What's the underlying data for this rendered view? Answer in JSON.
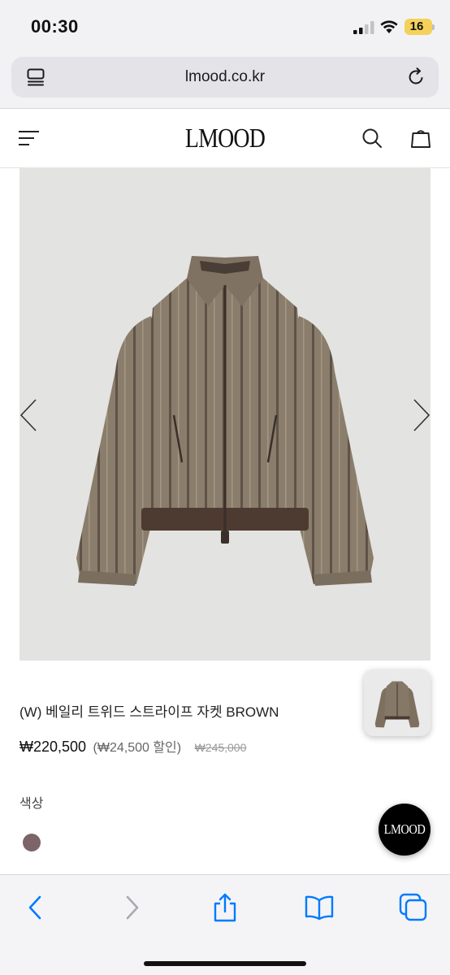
{
  "status_bar": {
    "time": "00:30",
    "battery": "16"
  },
  "browser": {
    "url": "lmood.co.kr",
    "icons": [
      "reader-icon",
      "reload-icon"
    ]
  },
  "site_header": {
    "brand": "LMOOD",
    "icons": [
      "menu-icon",
      "search-icon",
      "shopping-bag-icon"
    ]
  },
  "product": {
    "name": "(W) 베일리 트위드 스트라이프 자켓 BROWN",
    "price": "₩220,500",
    "discount": "(₩24,500 할인)",
    "original_price": "₩245,000",
    "color_label": "색상",
    "swatch_color": "#7c6468"
  },
  "floating_button": {
    "label": "LMOOD"
  },
  "toolbar": {
    "icons": [
      "back-arrow-icon",
      "forward-arrow-icon",
      "share-icon",
      "bookmarks-icon",
      "tabs-icon"
    ]
  },
  "colors": {
    "accent": "#007aff",
    "disabled": "#a9a9ae",
    "battery": "#f5d15a"
  }
}
